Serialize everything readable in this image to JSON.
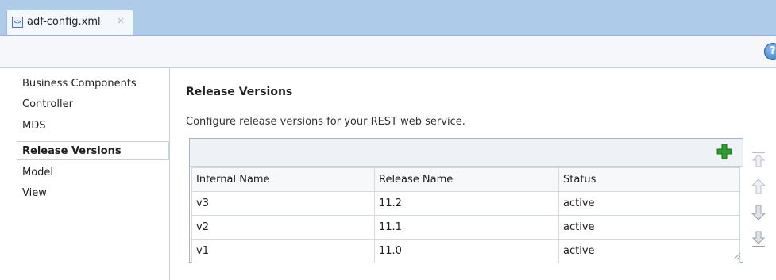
{
  "tab": {
    "icon": "xml-file-icon",
    "label": "adf-config.xml",
    "close_glyph": "×"
  },
  "toolbar": {
    "help_icon": "help-icon",
    "help_glyph": "?"
  },
  "sidebar": {
    "items": [
      {
        "label": "Business Components",
        "selected": false
      },
      {
        "label": "Controller",
        "selected": false
      },
      {
        "label": "MDS",
        "selected": false
      },
      {
        "label": "Release Versions",
        "selected": true
      },
      {
        "label": "Model",
        "selected": false
      },
      {
        "label": "View",
        "selected": false
      }
    ]
  },
  "main": {
    "title": "Release Versions",
    "description": "Configure release versions for your REST web service.",
    "table": {
      "add_icon": "add-icon",
      "columns": [
        "Internal Name",
        "Release Name",
        "Status"
      ],
      "rows": [
        [
          "v3",
          "11.2",
          "active"
        ],
        [
          "v2",
          "11.1",
          "active"
        ],
        [
          "v1",
          "11.0",
          "active"
        ]
      ]
    },
    "reorder_buttons": [
      "move-to-top-icon",
      "move-up-icon",
      "move-down-icon",
      "move-to-bottom-icon"
    ]
  },
  "colors": {
    "tabbar_bg": "#aecbe9",
    "add_green": "#2e9e2e",
    "arrow_gray": "#b9c0c8"
  }
}
